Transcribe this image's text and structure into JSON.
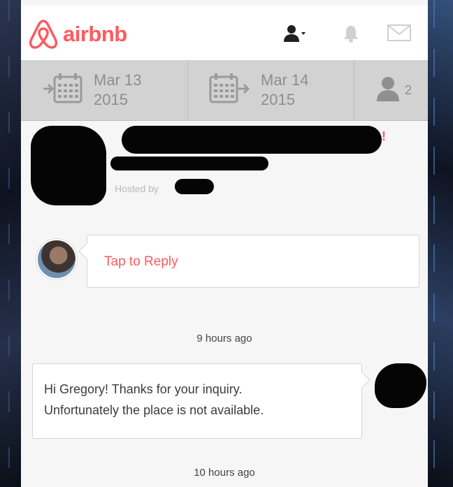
{
  "header": {
    "brand": "airbnb",
    "icons": [
      "airbnb-logo-icon",
      "user-menu-icon",
      "notification-bell-icon",
      "messages-envelope-icon"
    ]
  },
  "date_bar": {
    "checkin": {
      "month_day": "Mar 13",
      "year": "2015"
    },
    "checkout": {
      "month_day": "Mar 14",
      "year": "2015"
    },
    "guests": "2"
  },
  "listing": {
    "hosted_by_label": "Hosted by",
    "alert_mark": "!"
  },
  "reply": {
    "label": "Tap to Reply"
  },
  "thread": {
    "first_time": "9 hours ago",
    "message_line1": "Hi Gregory! Thanks for your inquiry.",
    "message_line2": "Unfortunately the place is not available.",
    "second_time": "10 hours ago"
  },
  "colors": {
    "brand": "#ff5a5f",
    "date_bar": "#d2d2d2",
    "background": "#f6f6f6"
  }
}
